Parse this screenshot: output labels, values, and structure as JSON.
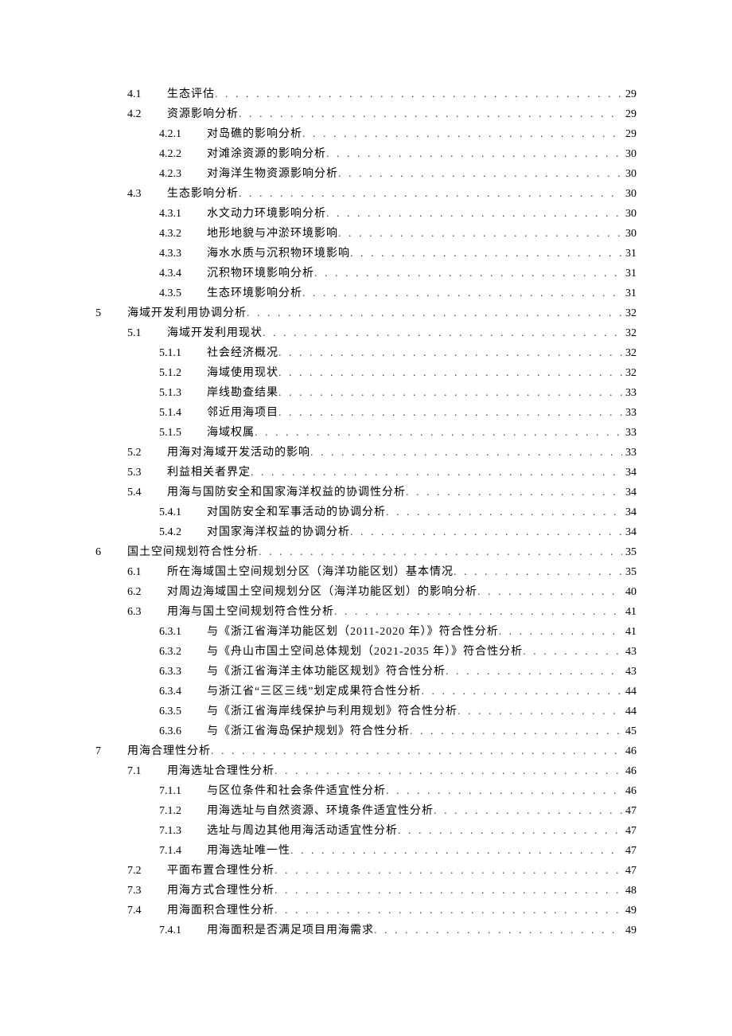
{
  "toc": [
    {
      "level": 2,
      "num": "4.1",
      "title": "生态评估",
      "page": "29"
    },
    {
      "level": 2,
      "num": "4.2",
      "title": "资源影响分析",
      "page": "29"
    },
    {
      "level": 3,
      "num": "4.2.1",
      "title": "对岛礁的影响分析",
      "page": "29"
    },
    {
      "level": 3,
      "num": "4.2.2",
      "title": "对滩涂资源的影响分析",
      "page": "30"
    },
    {
      "level": 3,
      "num": "4.2.3",
      "title": "对海洋生物资源影响分析",
      "page": "30"
    },
    {
      "level": 2,
      "num": "4.3",
      "title": "生态影响分析",
      "page": "30"
    },
    {
      "level": 3,
      "num": "4.3.1",
      "title": "水文动力环境影响分析",
      "page": "30"
    },
    {
      "level": 3,
      "num": "4.3.2",
      "title": "地形地貌与冲淤环境影响",
      "page": "30"
    },
    {
      "level": 3,
      "num": "4.3.3",
      "title": "海水水质与沉积物环境影响",
      "page": "31"
    },
    {
      "level": 3,
      "num": "4.3.4",
      "title": "沉积物环境影响分析",
      "page": "31"
    },
    {
      "level": 3,
      "num": "4.3.5",
      "title": "生态环境影响分析",
      "page": "31"
    },
    {
      "level": 1,
      "num": "5",
      "title": "海域开发利用协调分析",
      "page": "32"
    },
    {
      "level": 2,
      "num": "5.1",
      "title": "海域开发利用现状",
      "page": "32"
    },
    {
      "level": 3,
      "num": "5.1.1",
      "title": "社会经济概况",
      "page": "32"
    },
    {
      "level": 3,
      "num": "5.1.2",
      "title": "海域使用现状",
      "page": "32"
    },
    {
      "level": 3,
      "num": "5.1.3",
      "title": "岸线勘查结果",
      "page": "33"
    },
    {
      "level": 3,
      "num": "5.1.4",
      "title": "邻近用海项目",
      "page": "33"
    },
    {
      "level": 3,
      "num": "5.1.5",
      "title": "海域权属",
      "page": "33"
    },
    {
      "level": 2,
      "num": "5.2",
      "title": "用海对海域开发活动的影响",
      "page": "33"
    },
    {
      "level": 2,
      "num": "5.3",
      "title": "利益相关者界定",
      "page": "34"
    },
    {
      "level": 2,
      "num": "5.4",
      "title": "用海与国防安全和国家海洋权益的协调性分析",
      "page": "34"
    },
    {
      "level": 3,
      "num": "5.4.1",
      "title": "对国防安全和军事活动的协调分析",
      "page": "34"
    },
    {
      "level": 3,
      "num": "5.4.2",
      "title": "对国家海洋权益的协调分析",
      "page": "34"
    },
    {
      "level": 1,
      "num": "6",
      "title": "国土空间规划符合性分析",
      "page": "35"
    },
    {
      "level": 2,
      "num": "6.1",
      "title": "所在海域国土空间规划分区（海洋功能区划）基本情况",
      "page": "35"
    },
    {
      "level": 2,
      "num": "6.2",
      "title": "对周边海域国土空间规划分区（海洋功能区划）的影响分析",
      "page": "40"
    },
    {
      "level": 2,
      "num": "6.3",
      "title": "用海与国土空间规划符合性分析",
      "page": "41"
    },
    {
      "level": 3,
      "num": "6.3.1",
      "title": "与《浙江省海洋功能区划（2011-2020 年）》符合性分析",
      "page": "41"
    },
    {
      "level": 3,
      "num": "6.3.2",
      "title": "与《舟山市国土空间总体规划（2021-2035 年）》符合性分析",
      "page": "43"
    },
    {
      "level": 3,
      "num": "6.3.3",
      "title": "与《浙江省海洋主体功能区规划》符合性分析",
      "page": "43"
    },
    {
      "level": 3,
      "num": "6.3.4",
      "title": "与浙江省“三区三线”划定成果符合性分析",
      "page": "44"
    },
    {
      "level": 3,
      "num": "6.3.5",
      "title": "与《浙江省海岸线保护与利用规划》符合性分析",
      "page": "44"
    },
    {
      "level": 3,
      "num": "6.3.6",
      "title": "与《浙江省海岛保护规划》符合性分析",
      "page": "45"
    },
    {
      "level": 1,
      "num": "7",
      "title": "用海合理性分析",
      "page": "46"
    },
    {
      "level": 2,
      "num": "7.1",
      "title": "用海选址合理性分析",
      "page": "46"
    },
    {
      "level": 3,
      "num": "7.1.1",
      "title": "与区位条件和社会条件适宜性分析",
      "page": "46"
    },
    {
      "level": 3,
      "num": "7.1.2",
      "title": "用海选址与自然资源、环境条件适宜性分析",
      "page": "47"
    },
    {
      "level": 3,
      "num": "7.1.3",
      "title": "选址与周边其他用海活动适宜性分析",
      "page": "47"
    },
    {
      "level": 3,
      "num": "7.1.4",
      "title": "用海选址唯一性",
      "page": "47"
    },
    {
      "level": 2,
      "num": "7.2",
      "title": "平面布置合理性分析",
      "page": "47"
    },
    {
      "level": 2,
      "num": "7.3",
      "title": "用海方式合理性分析",
      "page": "48"
    },
    {
      "level": 2,
      "num": "7.4",
      "title": "用海面积合理性分析",
      "page": "49"
    },
    {
      "level": 3,
      "num": "7.4.1",
      "title": "用海面积是否满足项目用海需求",
      "page": "49"
    }
  ]
}
